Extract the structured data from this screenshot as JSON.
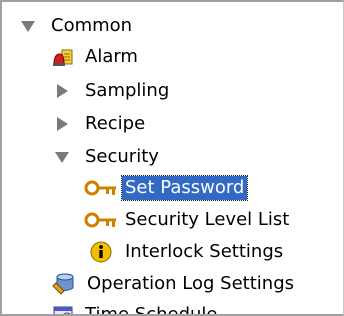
{
  "tree": {
    "common": {
      "label": "Common"
    },
    "alarm": {
      "label": "Alarm",
      "icon": "alarm-icon"
    },
    "sampling": {
      "label": "Sampling"
    },
    "recipe": {
      "label": "Recipe"
    },
    "security": {
      "label": "Security"
    },
    "set_password": {
      "label": "Set Password",
      "icon": "key-icon",
      "selected": true
    },
    "security_level_list": {
      "label": "Security Level List",
      "icon": "key-icon"
    },
    "interlock_settings": {
      "label": "Interlock Settings",
      "icon": "info-icon"
    },
    "operation_log_settings": {
      "label": "Operation Log Settings",
      "icon": "database-icon"
    },
    "time_schedule": {
      "label": "Time Schedule",
      "icon": "schedule-icon"
    }
  },
  "colors": {
    "selection": "#316ac5",
    "expander": "#7a7a7a",
    "key": "#c88400",
    "info": "#f0c000"
  }
}
